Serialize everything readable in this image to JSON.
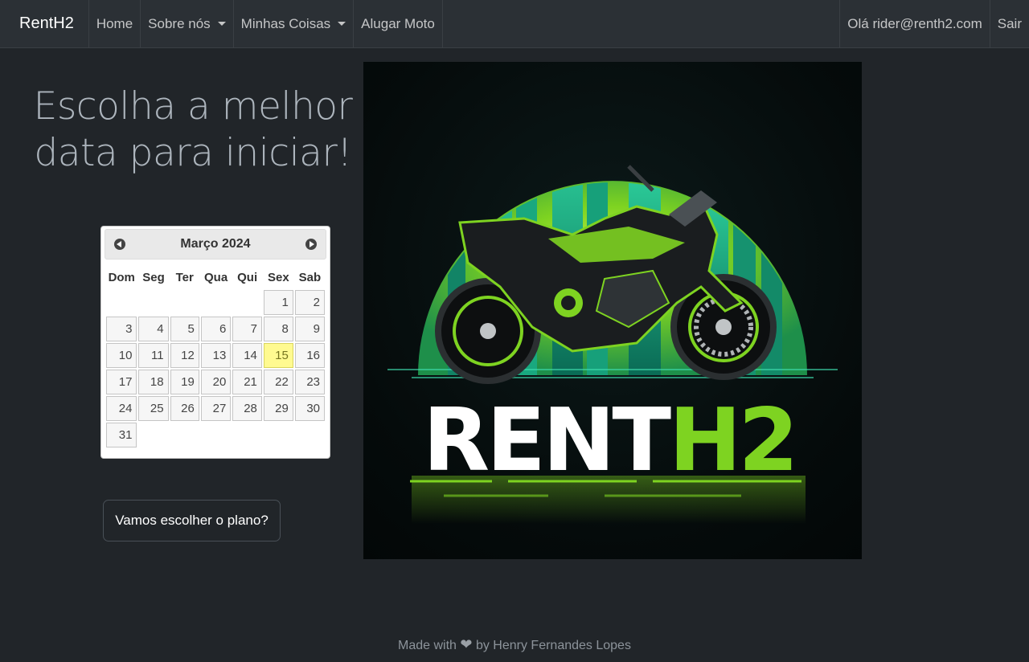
{
  "navbar": {
    "brand": "RentH2",
    "home": "Home",
    "about": "Sobre nós",
    "my_things": "Minhas Coisas",
    "rent": "Alugar Moto",
    "greeting": "Olá rider@renth2.com",
    "logout": "Sair"
  },
  "heading": {
    "line1": "Escolha a melhor",
    "line2": "data para iniciar!"
  },
  "calendar": {
    "title": "Março 2024",
    "weekdays": [
      "Dom",
      "Seg",
      "Ter",
      "Qua",
      "Qui",
      "Sex",
      "Sab"
    ],
    "weeks": [
      [
        "",
        "",
        "",
        "",
        "",
        "1",
        "2"
      ],
      [
        "3",
        "4",
        "5",
        "6",
        "7",
        "8",
        "9"
      ],
      [
        "10",
        "11",
        "12",
        "13",
        "14",
        "15",
        "16"
      ],
      [
        "17",
        "18",
        "19",
        "20",
        "21",
        "22",
        "23"
      ],
      [
        "24",
        "25",
        "26",
        "27",
        "28",
        "29",
        "30"
      ],
      [
        "31",
        "",
        "",
        "",
        "",
        "",
        ""
      ]
    ],
    "highlighted": "15"
  },
  "button": {
    "label": "Vamos escolher o plano?"
  },
  "logo": {
    "word_white": "RENT",
    "word_green": "H2"
  },
  "footer": {
    "made_with": "Made with",
    "heart_icon": "heart-icon",
    "by": "by Henry Fernandes Lopes"
  },
  "colors": {
    "background": "#212529",
    "navbar": "#2b3035",
    "accent_green": "#7ed321",
    "today_highlight": "#fffa90"
  }
}
